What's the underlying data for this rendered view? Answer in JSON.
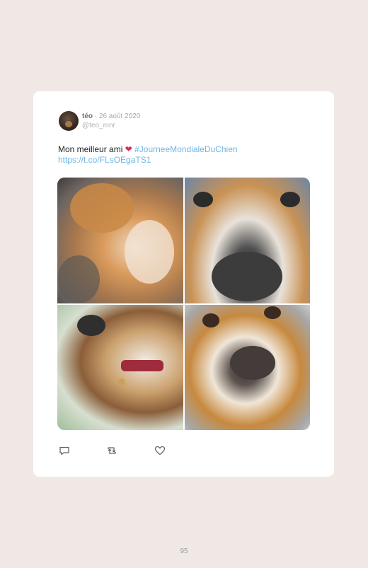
{
  "tweet": {
    "author_name": "téo",
    "separator": "·",
    "date": "26 août 2020",
    "handle": "@teo_mnr",
    "text_start": "Mon meilleur ami",
    "heart_emoji": "❤",
    "hashtag": "#JourneeMondialeDuChien",
    "link": "https://t.co/FLsOEgaTS1",
    "photos": [
      {
        "subject": "sleeping-beagle-photo"
      },
      {
        "subject": "beagle-nose-closeup-photo"
      },
      {
        "subject": "beagle-profile-collar-photo"
      },
      {
        "subject": "beagle-face-photo"
      }
    ],
    "actions": {
      "reply_icon": "reply-icon",
      "retweet_icon": "retweet-icon",
      "like_icon": "like-heart-icon"
    }
  },
  "page": {
    "number": "95"
  },
  "colors": {
    "background": "#efe8e4",
    "card": "#ffffff",
    "link": "#6fb6e6",
    "heart": "#e0245e"
  }
}
